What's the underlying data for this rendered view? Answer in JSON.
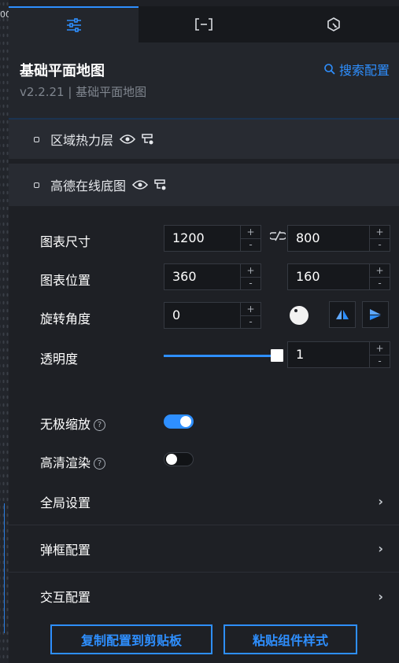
{
  "canvas_fragment": "00",
  "tabs": [
    {
      "name": "settings",
      "icon": "sliders-icon",
      "active": true
    },
    {
      "name": "data",
      "icon": "bracket-icon",
      "active": false
    },
    {
      "name": "interaction",
      "icon": "interaction-icon",
      "active": false
    }
  ],
  "header": {
    "title": "基础平面地图",
    "version": "v2.2.21 | 基础平面地图",
    "search_label": "搜索配置"
  },
  "layers": [
    {
      "label": "区域热力层"
    },
    {
      "label": "高德在线底图"
    }
  ],
  "settings": {
    "size": {
      "label": "图表尺寸",
      "width": "1200",
      "height": "800"
    },
    "position": {
      "label": "图表位置",
      "x": "360",
      "y": "160"
    },
    "rotation": {
      "label": "旋转角度",
      "angle": "0"
    },
    "opacity": {
      "label": "透明度",
      "value": "1",
      "level": 1
    },
    "infinite_zoom": {
      "label": "无极缩放",
      "help": "?",
      "enabled": true
    },
    "hd_render": {
      "label": "高清渲染",
      "help": "?",
      "enabled": false
    },
    "stepper": {
      "plus": "+",
      "minus": "-"
    }
  },
  "groups": [
    {
      "label": "全局设置",
      "chevron": "›"
    },
    {
      "label": "弹框配置",
      "chevron": "›"
    },
    {
      "label": "交互配置",
      "chevron": "›"
    }
  ],
  "footer": {
    "copy_label": "复制配置到剪贴板",
    "paste_label": "粘贴组件样式"
  },
  "colors": {
    "accent": "#2e8fff",
    "panel": "#1e2025",
    "layer_row": "#282b32"
  }
}
